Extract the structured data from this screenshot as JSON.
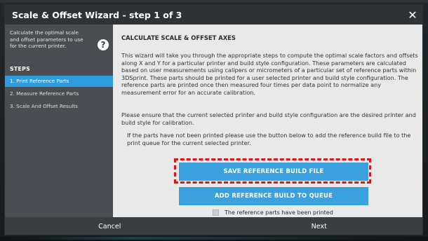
{
  "dialog": {
    "title": "Scale & Offset Wizard - step 1 of 3",
    "close_icon": "close-icon",
    "close_glyph": "✕"
  },
  "sidebar": {
    "description": "Calculate the optimal scale and offset parameters to use for the current printer.",
    "help_icon": "help-icon",
    "help_glyph": "?",
    "steps_heading": "STEPS",
    "steps": [
      {
        "label": "1. Print Reference Parts",
        "active": true
      },
      {
        "label": "2. Measure Reference Parts",
        "active": false
      },
      {
        "label": "3. Scale And Offset Results",
        "active": false
      }
    ]
  },
  "content": {
    "heading": "CALCULATE SCALE & OFFSET AXES",
    "paragraph1": "This wizard will take you through the appropriate steps to compute the optimal scale factors and offsets along X and Y for a particular printer and build style configuration. These parameters are calculated based on user measurements using calipers or micrometers of a particular set of reference parts within 3DSprint. These parts should be printed for a user selected printer and build style configuration. The reference parts are printed once then measured four times per data point to normalize any measurement error for an accurate calibration.",
    "paragraph2": "Please ensure that the current selected printer and build style configuration are the desired printer and build style for calibration.",
    "paragraph3": "If the parts have not been printed please use the button below to add the reference build file to the print queue for the current selected printer.",
    "save_button": "SAVE REFERENCE BUILD FILE",
    "queue_button": "ADD REFERENCE BUILD TO QUEUE",
    "checkbox_label": "The reference parts have been printed",
    "checkbox_checked": false
  },
  "footer": {
    "cancel": "Cancel",
    "next": "Next"
  },
  "colors": {
    "accent": "#3aa0de",
    "active_step": "#2f9ce0",
    "highlight": "#e0141b",
    "dialog_bg": "#3a3e41",
    "sidebar_bg": "#4a4e52",
    "content_bg": "#e9e9e9"
  }
}
